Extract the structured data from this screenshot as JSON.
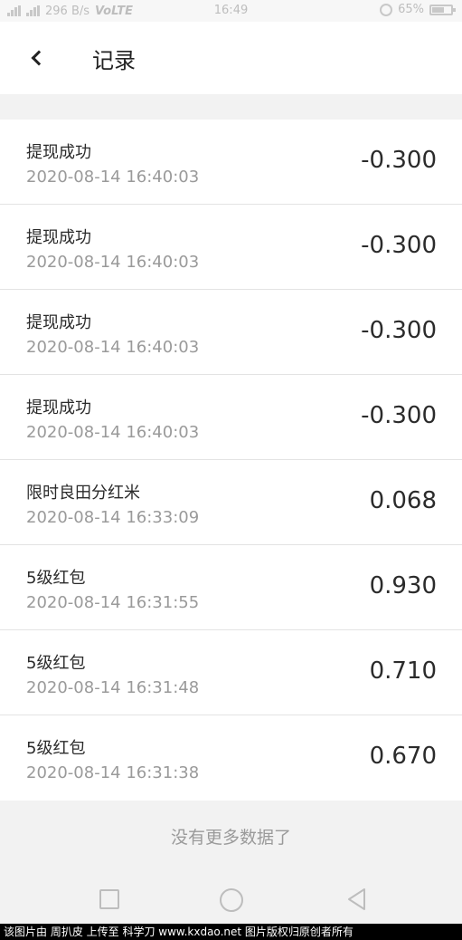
{
  "status_bar": {
    "network_speed": "296 B/s",
    "network_type": "VoLTE",
    "time": "16:49",
    "battery_percent": "65%",
    "battery_level": 0.65
  },
  "header": {
    "title": "记录"
  },
  "records": [
    {
      "title": "提现成功",
      "time": "2020-08-14 16:40:03",
      "amount": "-0.300"
    },
    {
      "title": "提现成功",
      "time": "2020-08-14 16:40:03",
      "amount": "-0.300"
    },
    {
      "title": "提现成功",
      "time": "2020-08-14 16:40:03",
      "amount": "-0.300"
    },
    {
      "title": "提现成功",
      "time": "2020-08-14 16:40:03",
      "amount": "-0.300"
    },
    {
      "title": "限时良田分红米",
      "time": "2020-08-14 16:33:09",
      "amount": "0.068"
    },
    {
      "title": "5级红包",
      "time": "2020-08-14 16:31:55",
      "amount": "0.930"
    },
    {
      "title": "5级红包",
      "time": "2020-08-14 16:31:48",
      "amount": "0.710"
    },
    {
      "title": "5级红包",
      "time": "2020-08-14 16:31:38",
      "amount": "0.670"
    }
  ],
  "footer": {
    "no_more_text": "没有更多数据了"
  },
  "watermark": "该图片由 周扒皮 上传至 科学刀 www.kxdao.net 图片版权归原创者所有"
}
